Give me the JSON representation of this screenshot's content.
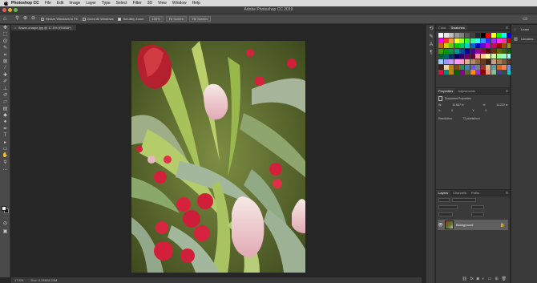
{
  "menubar": {
    "apple": "",
    "items": [
      "Photoshop CC",
      "File",
      "Edit",
      "Image",
      "Layer",
      "Type",
      "Select",
      "Filter",
      "3D",
      "View",
      "Window",
      "Help"
    ]
  },
  "window": {
    "title": "Adobe Photoshop CC 2019"
  },
  "options_bar": {
    "resize_windows_label": "Resize Windows to Fit",
    "zoom_all_windows_label": "Zoom All Windows",
    "scrubby_zoom_label": "Scrubby Zoom",
    "zoom_percent": "100%",
    "fit_screen_label": "Fit Screen",
    "fill_screen_label": "Fill Screen"
  },
  "document": {
    "tab_label": "flower-charpe.jpg @ 17.5% (RGB/8*)"
  },
  "status_bar": {
    "zoom": "17.5%",
    "doc_size": "Doc: 4.24M/4.24M"
  },
  "color_panel": {
    "tabs": [
      "Color",
      "Swatches"
    ],
    "active_tab": "Swatches",
    "swatches": [
      "#ffffff",
      "#e6e6e6",
      "#bfbfbf",
      "#999999",
      "#7f7f7f",
      "#595959",
      "#404040",
      "#262626",
      "#000000",
      "#ff0000",
      "#ffff00",
      "#00ff00",
      "#00ffff",
      "#0000ff",
      "#ff00ff",
      "#ff3333",
      "#ff9933",
      "#ffff33",
      "#99ff33",
      "#33ff33",
      "#33ff99",
      "#33ffff",
      "#3399ff",
      "#3333ff",
      "#9933ff",
      "#ff33ff",
      "#ff3399",
      "#cc0000",
      "#cc6600",
      "#cccc00",
      "#66cc00",
      "#00cc00",
      "#00cc66",
      "#00cccc",
      "#0066cc",
      "#0000cc",
      "#6600cc",
      "#cc00cc",
      "#cc0066",
      "#990000",
      "#994c00",
      "#999900",
      "#4c9900",
      "#009900",
      "#00994c",
      "#009999",
      "#004c99",
      "#000099",
      "#4c0099",
      "#990099",
      "#99004c",
      "#660000",
      "#663300",
      "#666600",
      "#336600",
      "#006600",
      "#006633",
      "#006666",
      "#003366",
      "#000066",
      "#330066",
      "#660066",
      "#660033",
      "#ff9999",
      "#ffcc99",
      "#ffff99",
      "#ccff99",
      "#99ff99",
      "#99ffcc",
      "#99ffff",
      "#99ccff",
      "#9999ff",
      "#cc99ff",
      "#ff99ff",
      "#ff99cc",
      "#d9b38c",
      "#b38c66",
      "#8c6640",
      "#664020",
      "#402010",
      "#c7a27c",
      "#a67c52",
      "#7c5a3a",
      "#5a3d24",
      "#3d2614",
      "#e5d3b3",
      "#b8860b",
      "#8b4513",
      "#2e8b57",
      "#4682b4",
      "#6a5acd",
      "#708090",
      "#a52a2a",
      "#deb887",
      "#5f9ea0",
      "#d2691e",
      "#ff7f50",
      "#6495ed",
      "#dc143c",
      "#008b8b",
      "#b8860b",
      "#006400",
      "#8b008b",
      "#556b2f",
      "#ff8c00",
      "#9932cc",
      "#8b0000",
      "#e9967a",
      "#8fbc8f",
      "#483d8b",
      "#2f4f4f",
      "#00ced1"
    ]
  },
  "properties_panel": {
    "tabs": [
      "Properties",
      "Adjustments"
    ],
    "active_tab": "Properties",
    "heading": "Document Properties",
    "width_label": "W:",
    "width_value": "10.667 in",
    "height_label": "H:",
    "height_value": "14.222 in",
    "x_label": "X:",
    "x_value": "0",
    "y_label": "Y:",
    "y_value": "0",
    "resolution_label": "Resolution:",
    "resolution_value": "72 pixels/inch"
  },
  "layers_panel": {
    "tabs": [
      "Layers",
      "Channels",
      "Paths"
    ],
    "active_tab": "Layers",
    "layers": [
      {
        "name": "Background",
        "visible": true,
        "locked": true
      }
    ]
  },
  "right_dock": {
    "items": [
      {
        "label": "Learn",
        "icon": "learn-icon"
      },
      {
        "label": "Libraries",
        "icon": "libraries-icon"
      }
    ]
  },
  "colors": {
    "canvas_bg": "#262626",
    "panel_bg": "#3a3a3a",
    "toolbar_bg": "#4a4a4a",
    "menubar_bg": "#d9d9d9",
    "layer_selected": "#5f5f5f"
  }
}
